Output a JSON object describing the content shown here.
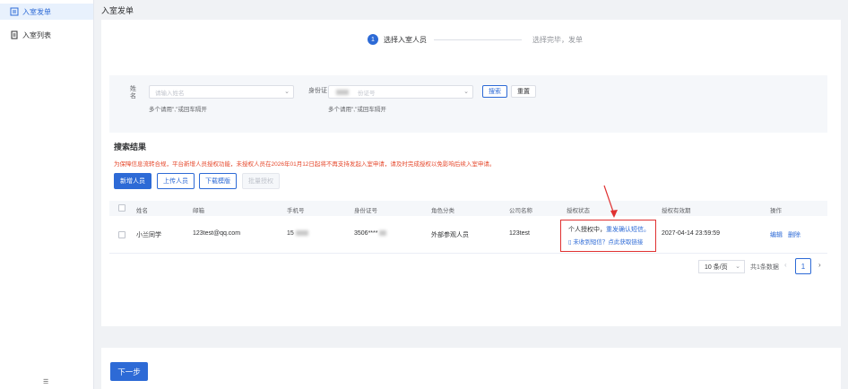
{
  "sidebar": {
    "items": [
      {
        "label": "入室发单",
        "icon": "home-icon",
        "active": true
      },
      {
        "label": "入室列表",
        "icon": "list-icon",
        "active": false
      }
    ],
    "collapse_label": "☰"
  },
  "page_title": "入室发单",
  "steps": [
    {
      "num": "1",
      "label": "选择入室人员"
    },
    {
      "label": "选择完毕，发单"
    }
  ],
  "search": {
    "name_label": "姓名",
    "name_placeholder": "请输入姓名",
    "name_hint": "多个请用\",\"或回车隔开",
    "id_label": "身份证",
    "id_placeholder": "份证号",
    "id_hint": "多个请用\",\"或回车隔开",
    "search_btn": "搜索",
    "reset_btn": "重置"
  },
  "results": {
    "title": "搜索结果",
    "warning": "为保障信息流转合规，平台新增人员授权功能，未授权人员在2026年01月12日起将不再支持发起入室申请，请及时完成授权以免影响后续入室申请。",
    "buttons": {
      "add": "新增人员",
      "upload": "上传人员",
      "download": "下载模版",
      "batch": "批量授权"
    }
  },
  "table": {
    "headers": [
      "姓名",
      "邮箱",
      "手机号",
      "身份证号",
      "角色分类",
      "公司名称",
      "授权状态",
      "授权有效期",
      "操作"
    ],
    "rows": [
      {
        "name": "小兰同学",
        "email": "123test@qq.com",
        "phone": "15",
        "id_number": "3506****",
        "role": "外部参观人员",
        "company": "123test",
        "auth_status": "个人授权中，",
        "auth_link": "重发确认短信。",
        "auth_help": "未收到短信？点此获取链接",
        "expiry": "2027-04-14 23:59:59",
        "edit": "编辑",
        "delete": "删除"
      }
    ]
  },
  "pagination": {
    "page_size": "10 条/页",
    "total": "共1条数据",
    "current": "1",
    "prev": "‹",
    "next": "›"
  },
  "footer": {
    "next_btn": "下一步"
  },
  "colors": {
    "primary": "#2d6ad6",
    "warning": "#e6492d",
    "highlight": "#e03131"
  }
}
